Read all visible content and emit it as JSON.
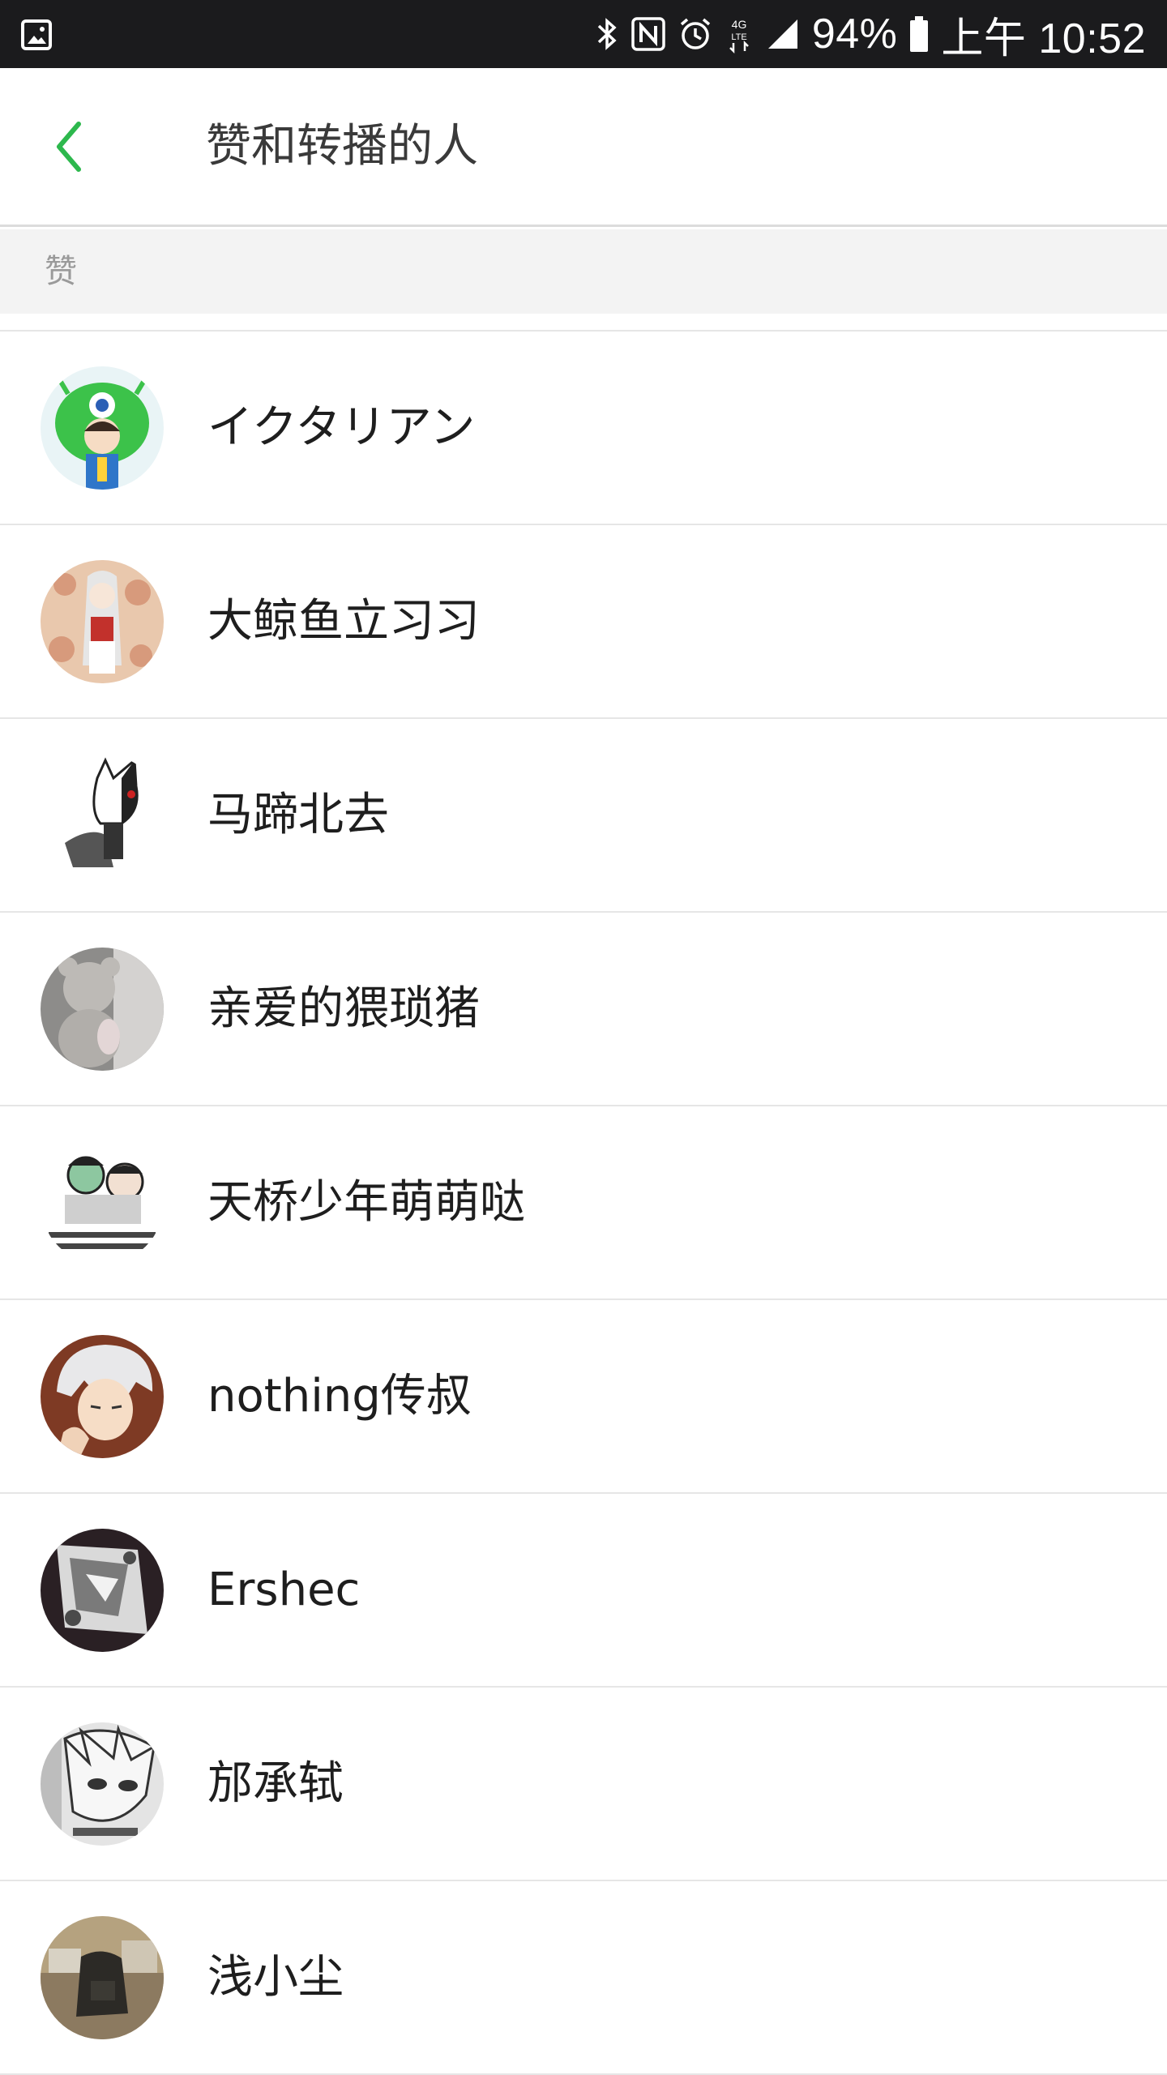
{
  "status_bar": {
    "battery_percent": "94%",
    "time": "上午 10:52",
    "icons": [
      "gallery-icon",
      "bluetooth-icon",
      "nfc-icon",
      "alarm-icon",
      "lte-icon",
      "signal-icon",
      "battery-icon"
    ]
  },
  "header": {
    "title": "赞和转播的人",
    "back_icon": "chevron-left-icon"
  },
  "colors": {
    "accent": "#2db84d",
    "status_bar_bg": "#1b1b1d",
    "section_bg": "#f3f3f3"
  },
  "section": {
    "label": "赞"
  },
  "users": [
    {
      "name": "イクタリアン",
      "avatar": "green-alien-avatar"
    },
    {
      "name": "大鲸鱼立习习",
      "avatar": "anime-girl-avatar"
    },
    {
      "name": "马蹄北去",
      "avatar": "fox-cartoon-avatar"
    },
    {
      "name": "亲爱的猥琐猪",
      "avatar": "teddy-bear-avatar"
    },
    {
      "name": "天桥少年萌萌哒",
      "avatar": "meme-comic-avatar"
    },
    {
      "name": "nothing传叔",
      "avatar": "silver-hair-anime-avatar"
    },
    {
      "name": "Ershec",
      "avatar": "sketch-art-avatar"
    },
    {
      "name": "邡承轼",
      "avatar": "manga-face-avatar"
    },
    {
      "name": "浅小尘",
      "avatar": "photo-avatar"
    }
  ]
}
